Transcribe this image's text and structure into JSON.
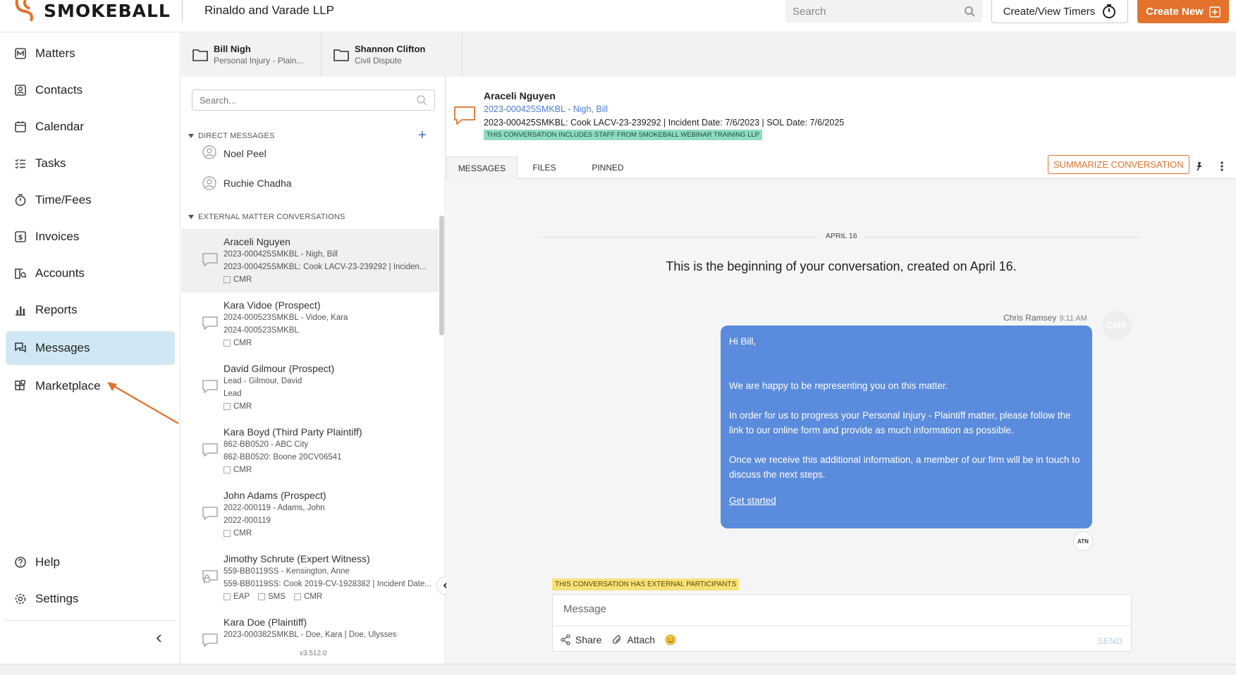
{
  "header": {
    "logo_text": "SMOKEBALL",
    "firm_name": "Rinaldo and Varade LLP",
    "search_placeholder": "Search",
    "timers_label": "Create/View Timers",
    "create_label": "Create New",
    "accent": "#e3722d"
  },
  "sidebar": {
    "items": [
      {
        "label": "Matters",
        "icon": "matters-icon"
      },
      {
        "label": "Contacts",
        "icon": "contacts-icon"
      },
      {
        "label": "Calendar",
        "icon": "calendar-icon"
      },
      {
        "label": "Tasks",
        "icon": "tasks-icon"
      },
      {
        "label": "Time/Fees",
        "icon": "stopwatch-icon"
      },
      {
        "label": "Invoices",
        "icon": "invoice-icon"
      },
      {
        "label": "Accounts",
        "icon": "accounts-icon"
      },
      {
        "label": "Reports",
        "icon": "reports-icon"
      },
      {
        "label": "Messages",
        "icon": "messages-icon",
        "active": true
      },
      {
        "label": "Marketplace",
        "icon": "marketplace-icon"
      }
    ],
    "bottom": [
      {
        "label": "Help",
        "icon": "help-icon"
      },
      {
        "label": "Settings",
        "icon": "gear-icon"
      }
    ]
  },
  "matter_tabs": [
    {
      "name": "Bill Nigh",
      "type": "Personal Injury - Plain..."
    },
    {
      "name": "Shannon Clifton",
      "type": "Civil Dispute"
    }
  ],
  "conversations": {
    "search_placeholder": "Search...",
    "direct_label": "DIRECT MESSAGES",
    "direct": [
      "Noel Peel",
      "Ruchie Chadha"
    ],
    "external_label": "EXTERNAL MATTER CONVERSATIONS",
    "items": [
      {
        "name": "Araceli Nguyen",
        "line2": "2023-000425SMKBL - Nigh, Bill",
        "line3": "2023-000425SMKBL: Cook LACV-23-239292 | Inciden...",
        "tags": [
          "CMR"
        ]
      },
      {
        "name": "Kara Vidoe (Prospect)",
        "line2": "2024-000523SMKBL - Vidoe, Kara",
        "line3": "2024-000523SMKBL",
        "tags": [
          "CMR"
        ]
      },
      {
        "name": "David Gilmour (Prospect)",
        "line2": "Lead - Gilmour, David",
        "line3": "Lead",
        "tags": [
          "CMR"
        ]
      },
      {
        "name": "Kara Boyd (Third Party Plaintiff)",
        "line2": "862-BB0520 - ABC City",
        "line3": "862-BB0520: Boone 20CV06541",
        "tags": [
          "CMR"
        ]
      },
      {
        "name": "John Adams (Prospect)",
        "line2": "2022-000119 - Adams, John",
        "line3": "2022-000119",
        "tags": [
          "CMR"
        ]
      },
      {
        "name": "Jimothy Schrute (Expert Witness)",
        "line2": "559-BB0119SS - Kensington, Anne",
        "line3": "559-BB0119SS: Cook 2019-CV-1928382 | Incident Date...",
        "tags": [
          "EAP",
          "SMS",
          "CMR"
        ]
      },
      {
        "name": "Kara Doe (Plaintiff)",
        "line2": "2023-000382SMKBL - Doe, Kara | Doe, Ulysses",
        "line3": "",
        "tags": []
      }
    ],
    "version": "v3.512.0"
  },
  "conversation": {
    "name": "Araceli Nguyen",
    "matter_link": "2023-000425SMKBL - Nigh, Bill",
    "info": "2023-000425SMKBL: Cook LACV-23-239292 | Incident Date: 7/6/2023 | SOL Date: 7/6/2025",
    "staff_badge": "THIS CONVERSATION INCLUDES STAFF FROM SMOKEBALL WEBINAR TRAINING LLP",
    "tabs": [
      "MESSAGES",
      "FILES",
      "PINNED"
    ],
    "summarize_label": "SUMMARIZE CONVERSATION",
    "date_label": "APRIL 16",
    "beginning_text": "This is the beginning of your conversation, created on April 16.",
    "message": {
      "sender": "Chris Ramsey",
      "time": "9:11 AM",
      "avatar": "CMR",
      "greeting": "Hi Bill,",
      "p1": "We are happy to be representing you on this matter.",
      "p2": "In order for us to progress your Personal Injury - Plaintiff matter, please follow the link to our online form and provide as much information as possible.",
      "p3": "Once we receive this additional information, a member of our firm will be in touch to discuss the next steps.",
      "link": "Get started",
      "read_by": "ATN"
    },
    "external_notice": "THIS CONVERSATION HAS EXTERNAL PARTICIPANTS",
    "compose": {
      "placeholder": "Message",
      "share_label": "Share",
      "attach_label": "Attach",
      "send_label": "SEND"
    }
  }
}
